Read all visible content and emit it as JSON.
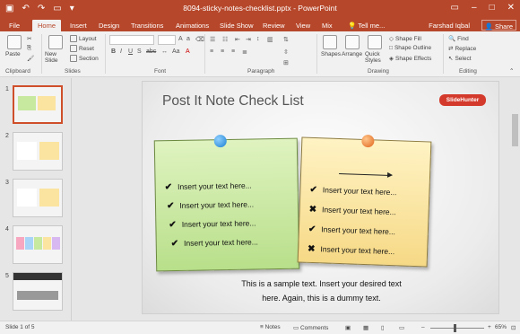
{
  "window": {
    "title": "8094-sticky-notes-checklist.pptx - PowerPoint",
    "user": "Farshad Iqbal",
    "share_label": "Share",
    "tell_me": "Tell me..."
  },
  "tabs": [
    "File",
    "Home",
    "Insert",
    "Design",
    "Transitions",
    "Animations",
    "Slide Show",
    "Review",
    "View",
    "Mix"
  ],
  "ribbon": {
    "clipboard": {
      "paste": "Paste",
      "label": "Clipboard"
    },
    "slides": {
      "new_slide": "New Slide",
      "layout": "Layout",
      "reset": "Reset",
      "section": "Section",
      "label": "Slides"
    },
    "font": {
      "label": "Font"
    },
    "paragraph": {
      "label": "Paragraph"
    },
    "drawing": {
      "shapes": "Shapes",
      "arrange": "Arrange",
      "quick_styles": "Quick Styles",
      "shape_fill": "Shape Fill",
      "shape_outline": "Shape Outline",
      "shape_effects": "Shape Effects",
      "label": "Drawing"
    },
    "editing": {
      "find": "Find",
      "replace": "Replace",
      "select": "Select",
      "label": "Editing"
    }
  },
  "thumbnails": [
    "1",
    "2",
    "3",
    "4",
    "5"
  ],
  "slide": {
    "title": "Post It Note Check List",
    "logo": "SlideHunter",
    "green_items": [
      "Insert your text here...",
      "Insert your text here...",
      "Insert your text here...",
      "Insert your text here..."
    ],
    "yellow_items": [
      {
        "mark": "✔",
        "text": "Insert your text here..."
      },
      {
        "mark": "✖",
        "text": "Insert your text here..."
      },
      {
        "mark": "✔",
        "text": "Insert your text here..."
      },
      {
        "mark": "✖",
        "text": "Insert your text here..."
      }
    ],
    "check": "✔",
    "sample_line1": "This is a sample text. Insert your desired text",
    "sample_line2": "here. Again, this is a dummy text."
  },
  "status": {
    "slide_info": "Slide 1 of 5",
    "notes": "Notes",
    "comments": "Comments",
    "zoom": "65%"
  },
  "colors": {
    "accent": "#b7472a",
    "green_note": "#c7e89f",
    "yellow_note": "#fbe3a0"
  }
}
